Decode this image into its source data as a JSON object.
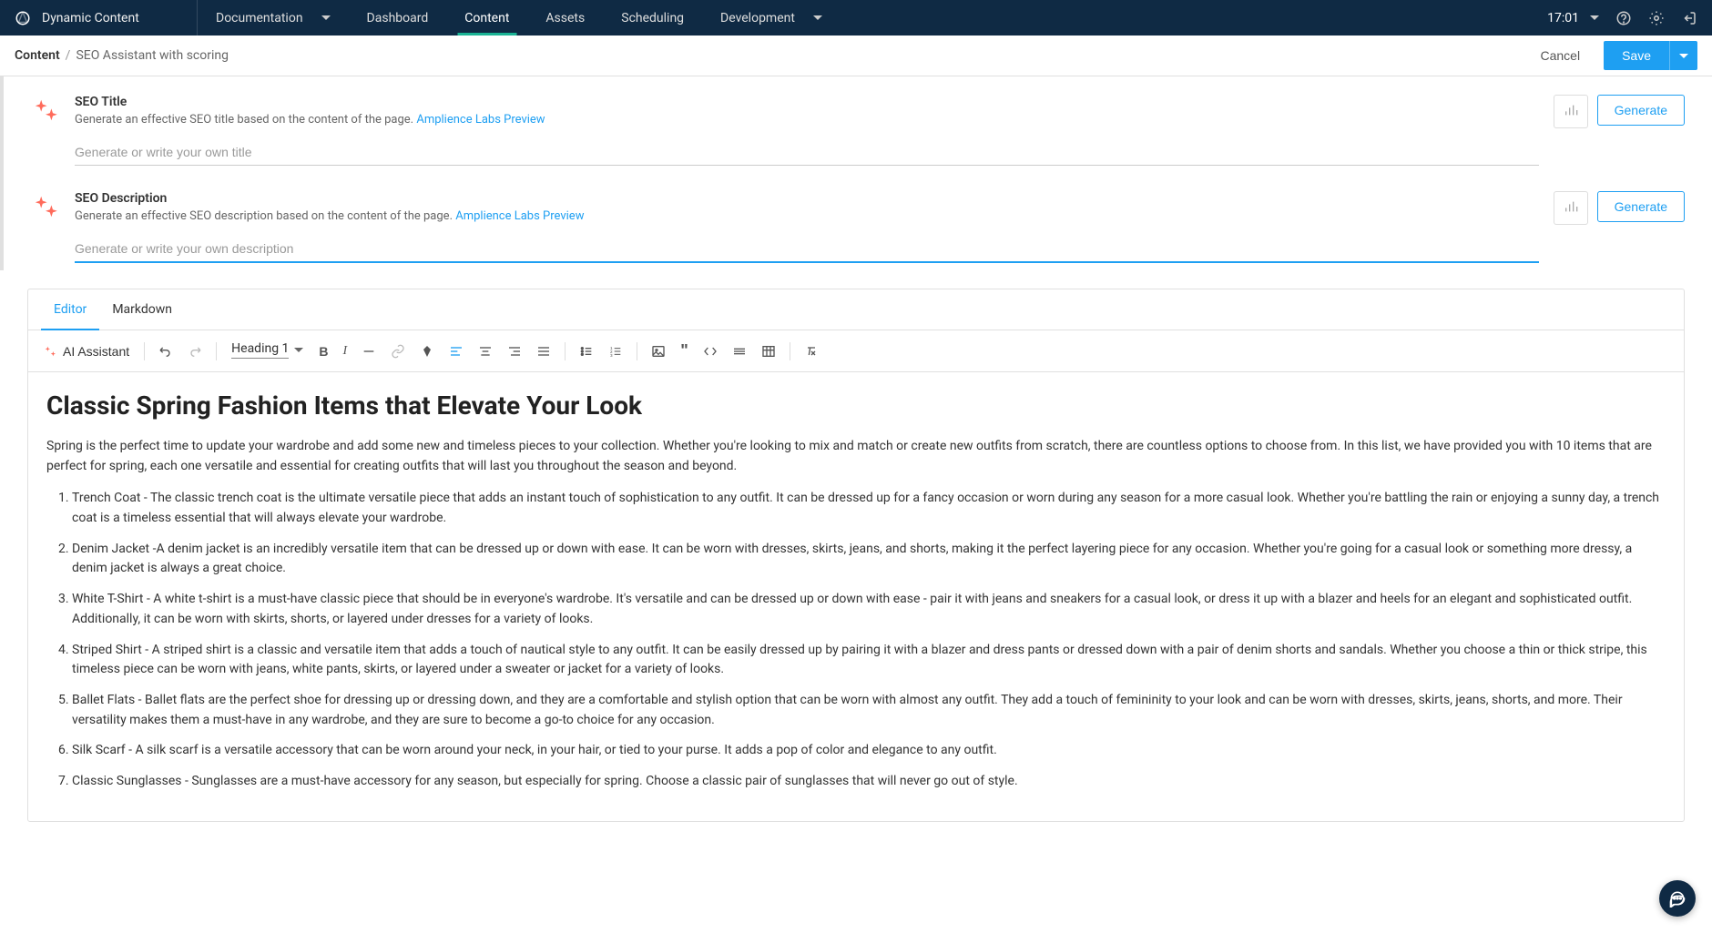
{
  "header": {
    "logo_text": "Dynamic Content",
    "nav": [
      {
        "label": "Documentation",
        "dropdown": true
      },
      {
        "label": "Dashboard"
      },
      {
        "label": "Content",
        "active": true
      },
      {
        "label": "Assets"
      },
      {
        "label": "Scheduling"
      },
      {
        "label": "Development",
        "dropdown": true
      }
    ],
    "time": "17:01"
  },
  "breadcrumb": {
    "root": "Content",
    "current": "SEO Assistant with scoring",
    "cancel": "Cancel",
    "save": "Save"
  },
  "seo_title": {
    "label": "SEO Title",
    "hint": "Generate an effective SEO title based on the content of the page.",
    "preview_link": "Amplience Labs Preview",
    "placeholder": "Generate or write your own title",
    "generate": "Generate"
  },
  "seo_description": {
    "label": "SEO Description",
    "hint": "Generate an effective SEO description based on the content of the page.",
    "preview_link": "Amplience Labs Preview",
    "placeholder": "Generate or write your own description",
    "generate": "Generate"
  },
  "editor": {
    "tabs": {
      "editor": "Editor",
      "markdown": "Markdown"
    },
    "ai_assistant": "AI Assistant",
    "heading_select": "Heading 1",
    "content": {
      "title": "Classic Spring Fashion Items that Elevate Your Look",
      "intro": "Spring is the perfect time to update your wardrobe and add some new and timeless pieces to your collection. Whether you're looking to mix and match or create new outfits from scratch, there are countless options to choose from. In this list, we have provided you with 10 items that are perfect for spring, each one versatile and essential for creating outfits that will last you throughout the season and beyond.",
      "items": [
        "Trench Coat - The classic trench coat is the ultimate versatile piece that adds an instant touch of sophistication to any outfit. It can be dressed up for a fancy occasion or worn during any season for a more casual look. Whether you're battling the rain or enjoying a sunny day, a trench coat is a timeless essential that will always elevate your wardrobe.",
        "Denim Jacket -A denim jacket is an incredibly versatile item that can be dressed up or down with ease. It can be worn with dresses, skirts, jeans, and shorts, making it the perfect layering piece for any occasion. Whether you're going for a casual look or something more dressy, a denim jacket is always a great choice.",
        "White T-Shirt - A white t-shirt is a must-have classic piece that should be in everyone's wardrobe. It's versatile and can be dressed up or down with ease - pair it with jeans and sneakers for a casual look, or dress it up with a blazer and heels for an elegant and sophisticated outfit. Additionally, it can be worn with skirts, shorts, or layered under dresses for a variety of looks.",
        "Striped Shirt - A striped shirt is a classic and versatile item that adds a touch of nautical style to any outfit. It can be easily dressed up by pairing it with a blazer and dress pants or dressed down with a pair of denim shorts and sandals. Whether you choose a thin or thick stripe, this timeless piece can be worn with jeans, white pants, skirts, or layered under a sweater or jacket for a variety of looks.",
        "Ballet Flats - Ballet flats are the perfect shoe for dressing up or dressing down, and they are a comfortable and stylish option that can be worn with almost any outfit. They add a touch of femininity to your look and can be worn with dresses, skirts, jeans, shorts, and more. Their versatility makes them a must-have in any wardrobe, and they are sure to become a go-to choice for any occasion.",
        "Silk Scarf - A silk scarf is a versatile accessory that can be worn around your neck, in your hair, or tied to your purse. It adds a pop of color and elegance to any outfit.",
        "Classic Sunglasses - Sunglasses are a must-have accessory for any season, but especially for spring. Choose a classic pair of sunglasses that will never go out of style."
      ]
    }
  }
}
